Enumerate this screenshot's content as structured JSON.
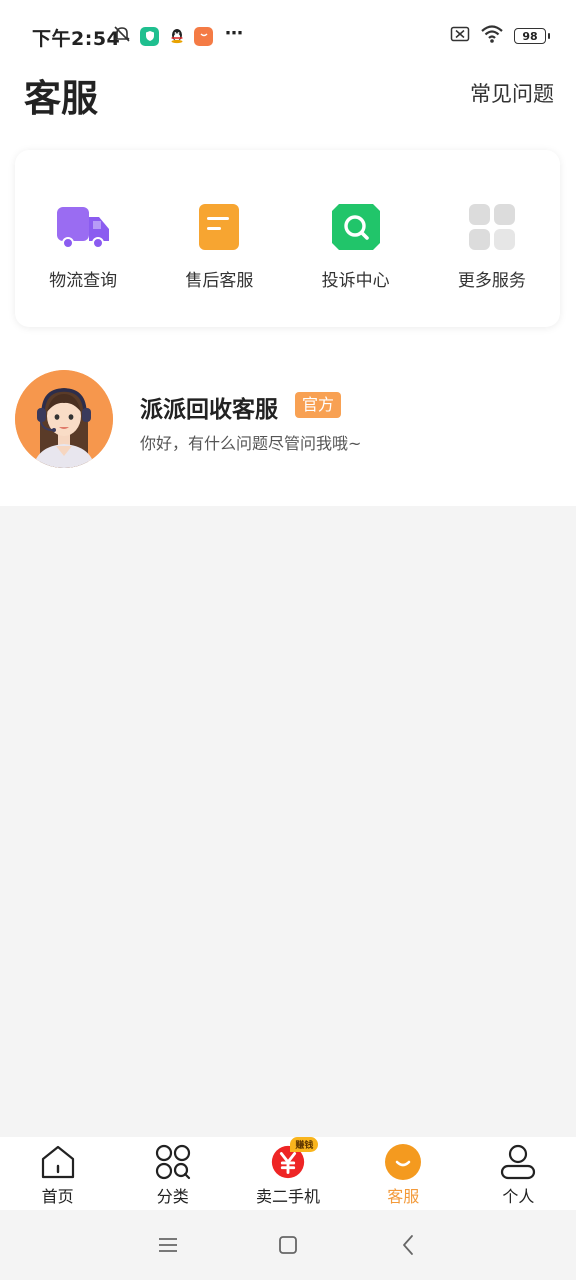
{
  "status_bar": {
    "time": "下午2:54",
    "battery": "98",
    "icons_left": [
      "mute-bell-icon",
      "shield-app-icon",
      "qq-penguin-icon",
      "shopping-app-icon"
    ],
    "icons_right": [
      "sim-off-icon",
      "wifi-icon",
      "battery-icon"
    ]
  },
  "header": {
    "title": "客服",
    "faq_label": "常见问题"
  },
  "services": [
    {
      "label": "物流查询",
      "icon": "truck-icon",
      "color": "#9a6cf2"
    },
    {
      "label": "售后客服",
      "icon": "document-icon",
      "color": "#f7a531"
    },
    {
      "label": "投诉中心",
      "icon": "search-icon",
      "color": "#21c56a"
    },
    {
      "label": "更多服务",
      "icon": "grid-icon",
      "color": "#dedede"
    }
  ],
  "contact": {
    "name": "派派回收客服",
    "badge": "官方",
    "message": "你好，有什么问题尽管问我哦~"
  },
  "bottom_nav": {
    "items": [
      {
        "label": "首页",
        "icon": "home-icon"
      },
      {
        "label": "分类",
        "icon": "category-icon"
      },
      {
        "label": "卖二手机",
        "icon": "yen-icon",
        "badge": "赚钱"
      },
      {
        "label": "客服",
        "icon": "service-smile-icon",
        "active": true
      },
      {
        "label": "个人",
        "icon": "person-icon"
      }
    ]
  },
  "colors": {
    "accent": "#f39a3a",
    "badge": "#f8a153",
    "background": "#f4f4f4"
  }
}
